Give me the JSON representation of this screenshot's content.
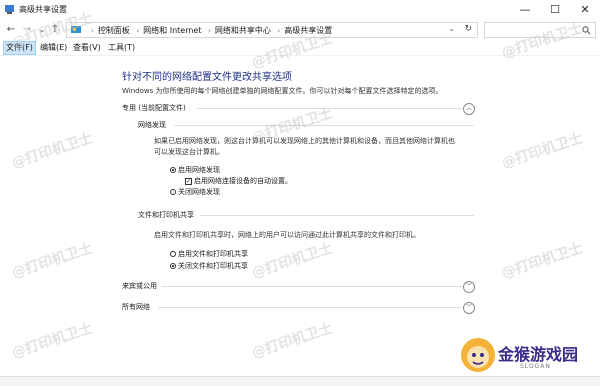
{
  "window": {
    "title": "高级共享设置"
  },
  "window_controls": {
    "minimize": "—",
    "maximize": "☐",
    "close": "✕"
  },
  "nav": {
    "back": "←",
    "forward": "→",
    "dropdown": "⌄",
    "up": "↑"
  },
  "address": {
    "crumbs": [
      "控制面板",
      "网络和 Internet",
      "网络和共享中心",
      "高级共享设置"
    ]
  },
  "menu": [
    {
      "label": "文件(F)"
    },
    {
      "label": "编辑(E)"
    },
    {
      "label": "查看(V)"
    },
    {
      "label": "工具(T)"
    }
  ],
  "page": {
    "heading": "针对不同的网络配置文件更改共享选项",
    "description": "Windows 为你所使用的每个网络创建单独的网络配置文件。你可以针对每个配置文件选择特定的选项。"
  },
  "profiles": {
    "private": {
      "title": "专用 (当前配置文件)",
      "discovery": {
        "title": "网络发现",
        "desc_line1": "如果已启用网络发现，则这台计算机可以发现网络上的其他计算机和设备，而且其他网络计算机也",
        "desc_line2": "可以发现这台计算机。",
        "opt_on": "启用网络发现",
        "opt_auto": "启用网络连接设备的自动设置。",
        "opt_off": "关闭网络发现"
      },
      "sharing": {
        "title": "文件和打印机共享",
        "desc": "启用文件和打印机共享时，网络上的用户可以访问通过此计算机共享的文件和打印机。",
        "opt_on": "启用文件和打印机共享",
        "opt_off": "关闭文件和打印机共享"
      }
    },
    "guest": {
      "title": "来宾或公用"
    },
    "all": {
      "title": "所有网络"
    }
  },
  "watermark": {
    "text": "@打印机卫士"
  },
  "logo": {
    "name": "金猴游戏园",
    "sub": "SLOGAN"
  },
  "colors": {
    "heading": "#1e3287",
    "menu_active": "#cce4f7",
    "logo": "#3a2a8a"
  }
}
